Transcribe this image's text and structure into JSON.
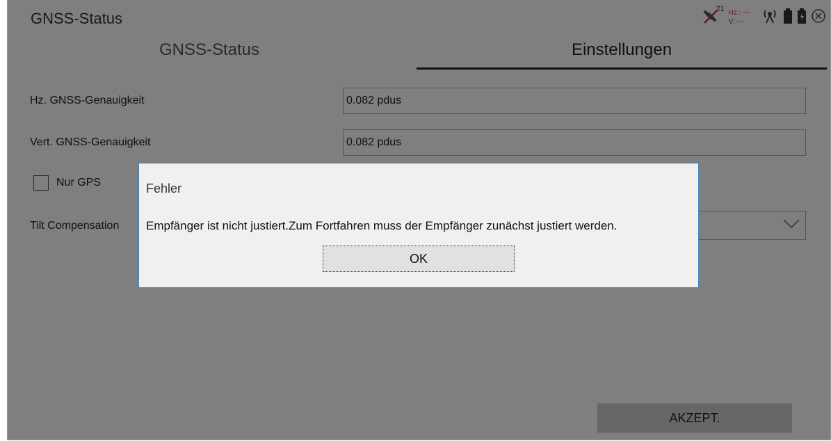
{
  "app": {
    "title": "GNSS-Status"
  },
  "status": {
    "sat_count": "21",
    "hz": "Hz.: ---",
    "v": "V: ---"
  },
  "tabs": [
    {
      "label": "GNSS-Status",
      "active": false
    },
    {
      "label": "Einstellungen",
      "active": true
    }
  ],
  "settings": {
    "hz_label": "Hz. GNSS-Genauigkeit",
    "hz_value": "0.082 pdus",
    "vert_label": "Vert. GNSS-Genauigkeit",
    "vert_value": "0.082 pdus",
    "gps_only_label": "Nur GPS",
    "tilt_label": "Tilt Compensation"
  },
  "accept_label": "AKZEPT.",
  "dialog": {
    "title": "Fehler",
    "message": "Empfänger ist nicht justiert.Zum Fortfahren muss der Empfänger zunächst justiert werden.",
    "ok_label": "OK"
  },
  "colors": {
    "accent": "#3b85c4",
    "warning": "#d22222"
  }
}
